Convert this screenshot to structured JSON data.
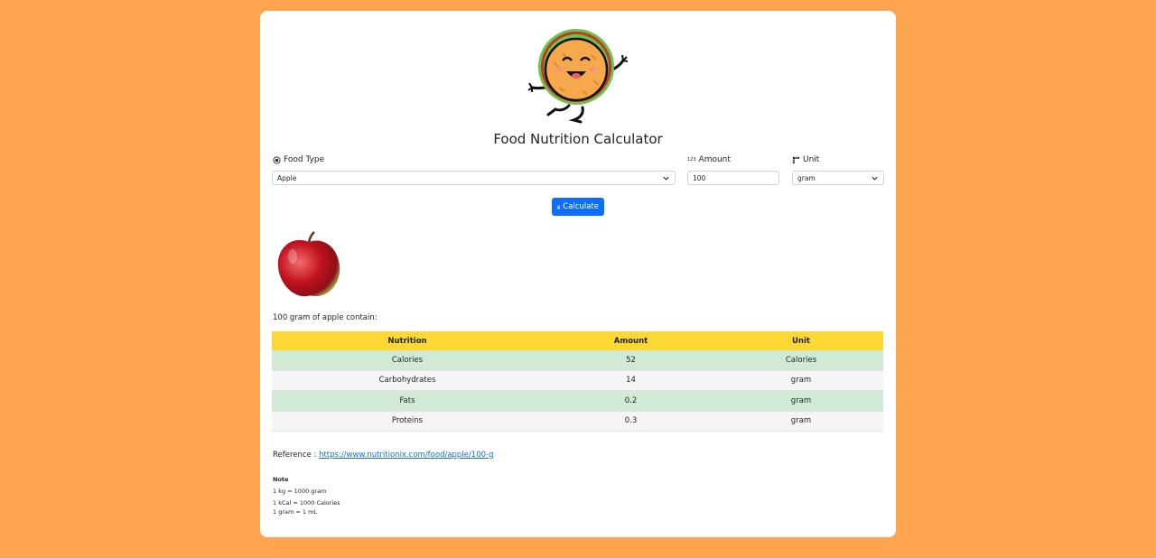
{
  "app": {
    "title": "Food Nutrition Calculator"
  },
  "form": {
    "food_type_label": "Food Type",
    "food_type_value": "Apple",
    "amount_label": "Amount",
    "amount_icon_text": "123",
    "amount_value": "100",
    "unit_label": "Unit",
    "unit_value": "gram",
    "calculate_label": "Calculate"
  },
  "result": {
    "summary": "100 gram of apple contain:",
    "headers": [
      "Nutrition",
      "Amount",
      "Unit"
    ],
    "rows": [
      {
        "nutrition": "Calories",
        "amount": "52",
        "unit": "Calories"
      },
      {
        "nutrition": "Carbohydrates",
        "amount": "14",
        "unit": "gram"
      },
      {
        "nutrition": "Fats",
        "amount": "0.2",
        "unit": "gram"
      },
      {
        "nutrition": "Proteins",
        "amount": "0.3",
        "unit": "gram"
      }
    ]
  },
  "reference": {
    "label": "Reference : ",
    "link": "https://www.nutritionix.com/food/apple/100-g"
  },
  "note": {
    "heading": "Note",
    "lines": [
      "1 kg = 1000 gram",
      "1 kCal = 1000 Calories",
      "1 gram = 1 mL"
    ]
  },
  "colors": {
    "background": "#ffa54f",
    "accent": "#0d6efd",
    "table_header": "#fdd835",
    "row_highlight": "#d1ead5"
  },
  "icons": [
    "taco-mascot-logo",
    "radio-icon",
    "number-icon",
    "ruler-icon",
    "chevron-down-icon",
    "calculator-icon",
    "apple-image"
  ]
}
